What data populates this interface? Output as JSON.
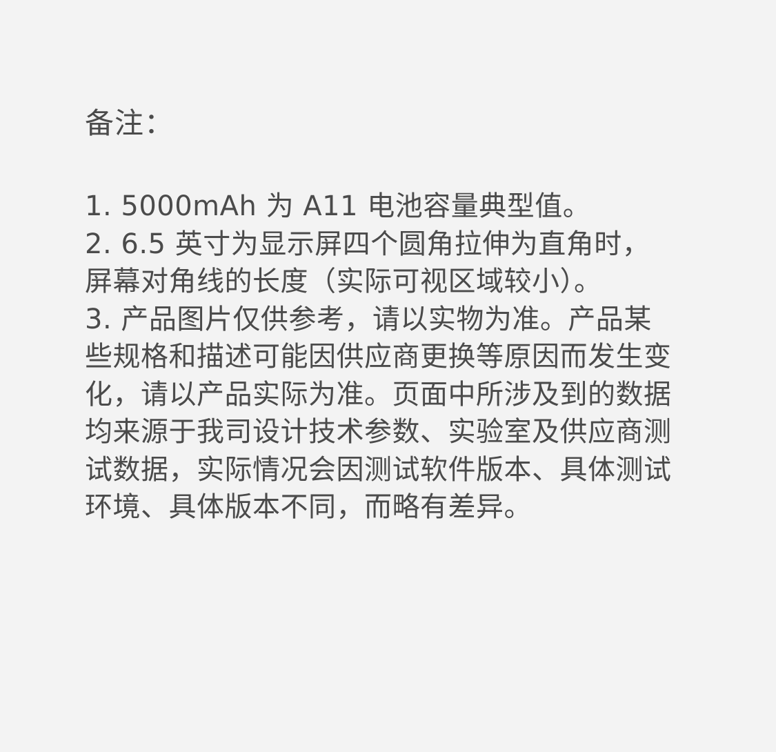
{
  "notes": {
    "title": "备注：",
    "lines": [
      "1. 5000mAh 为 A11 电池容量典型值。",
      "2. 6.5 英寸为显示屏四个圆角拉伸为直角时，",
      "屏幕对角线的长度（实际可视区域较小）。",
      "3. 产品图片仅供参考，请以实物为准。产品某",
      "些规格和描述可能因供应商更换等原因而发生变",
      "化，请以产品实际为准。页面中所涉及到的数据",
      "均来源于我司设计技术参数、实验室及供应商测",
      "试数据，实际情况会因测试软件版本、具体测试",
      "环境、具体版本不同，而略有差异。"
    ]
  }
}
